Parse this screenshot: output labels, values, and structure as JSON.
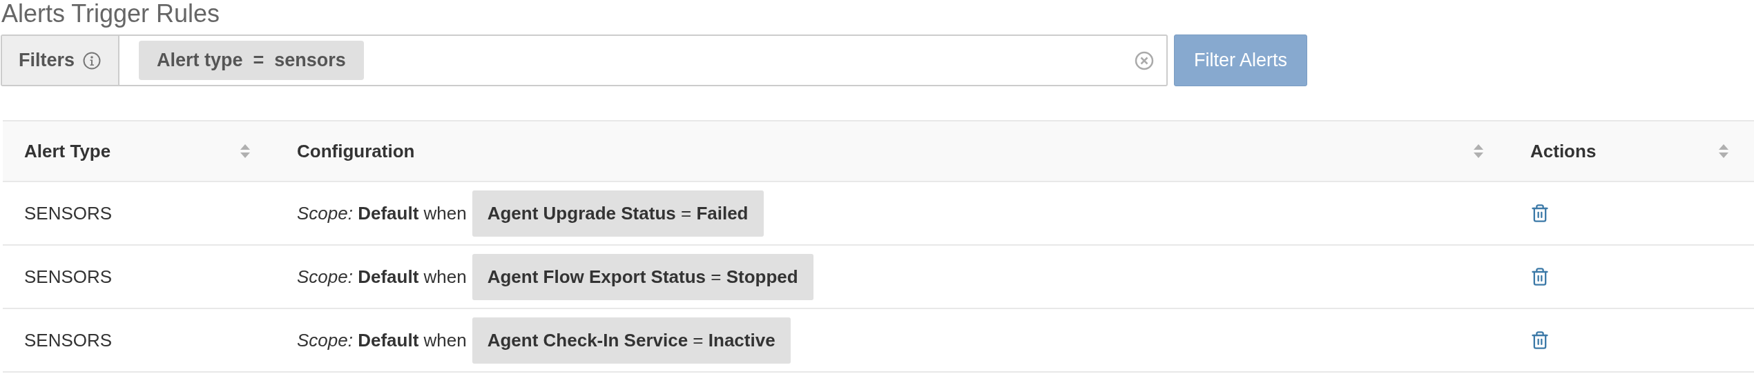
{
  "title": "Alerts Trigger Rules",
  "filters": {
    "label": "Filters",
    "chips": [
      "Alert type  =  sensors"
    ],
    "button": "Filter Alerts"
  },
  "table": {
    "columns": [
      "Alert Type",
      "Configuration",
      "Actions"
    ],
    "rows": [
      {
        "alert_type": "SENSORS",
        "scope": "*Scope:* **Default** when",
        "condition": "**Agent Upgrade Status** = **Failed**"
      },
      {
        "alert_type": "SENSORS",
        "scope": "*Scope:* **Default** when",
        "condition": "**Agent Flow Export Status** = **Stopped**"
      },
      {
        "alert_type": "SENSORS",
        "scope": "*Scope:* **Default** when",
        "condition": "**Agent Check-In Service** = **Inactive**"
      }
    ]
  }
}
